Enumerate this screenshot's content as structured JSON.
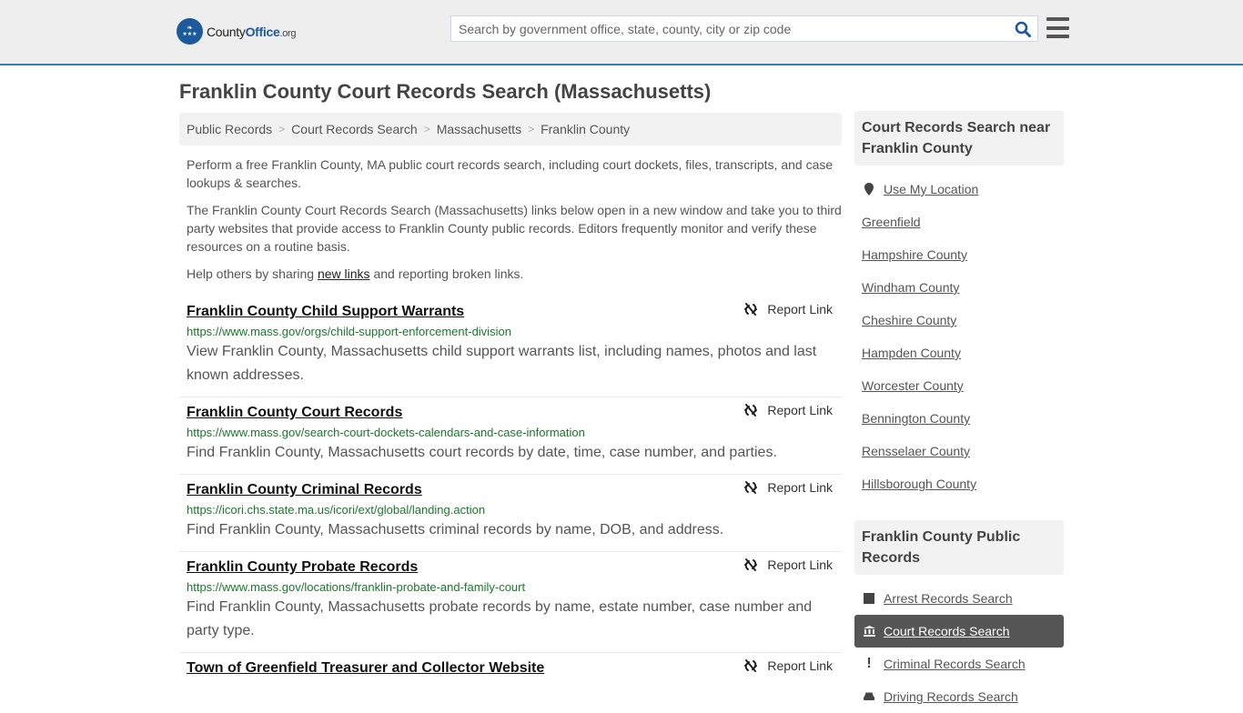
{
  "header": {
    "logo": {
      "name_part1": "County",
      "name_part2": "Office",
      "name_suffix": ".org"
    },
    "search": {
      "placeholder": "Search by government office, state, county, city or zip code",
      "value": ""
    },
    "icons": {
      "search": "search-icon",
      "menu": "hamburger-menu-icon"
    }
  },
  "page": {
    "title": "Franklin County Court Records Search (Massachusetts)"
  },
  "breadcrumb": [
    {
      "label": "Public Records"
    },
    {
      "label": "Court Records Search"
    },
    {
      "label": "Massachusetts"
    },
    {
      "label": "Franklin County"
    }
  ],
  "intro": {
    "p1": "Perform a free Franklin County, MA public court records search, including court dockets, files, transcripts, and case lookups & searches.",
    "p2": "The Franklin County Court Records Search (Massachusetts) links below open in a new window and take you to third party websites that provide access to Franklin County public records. Editors frequently monitor and verify these resources on a routine basis.",
    "p3_before": "Help others by sharing ",
    "p3_link": "new links",
    "p3_after": " and reporting broken links."
  },
  "report_label": "Report Link",
  "links": [
    {
      "title": "Franklin County Child Support Warrants",
      "url": "https://www.mass.gov/orgs/child-support-enforcement-division",
      "description": "View Franklin County, Massachusetts child support warrants list, including names, photos and last known addresses."
    },
    {
      "title": "Franklin County Court Records",
      "url": "https://www.mass.gov/search-court-dockets-calendars-and-case-information",
      "description": "Find Franklin County, Massachusetts court records by date, time, case number, and parties."
    },
    {
      "title": "Franklin County Criminal Records",
      "url": "https://icori.chs.state.ma.us/icori/ext/global/landing.action",
      "description": "Find Franklin County, Massachusetts criminal records by name, DOB, and address."
    },
    {
      "title": "Franklin County Probate Records",
      "url": "https://www.mass.gov/locations/franklin-probate-and-family-court",
      "description": "Find Franklin County, Massachusetts probate records by name, estate number, case number and party type."
    },
    {
      "title": "Town of Greenfield Treasurer and Collector Website",
      "url": "",
      "description": ""
    }
  ],
  "sidebar": {
    "nearby": {
      "heading": "Court Records Search near Franklin County",
      "use_location": "Use My Location",
      "items": [
        "Greenfield",
        "Hampshire County",
        "Windham County",
        "Cheshire County",
        "Hampden County",
        "Worcester County",
        "Bennington County",
        "Rensselaer County",
        "Hillsborough County"
      ]
    },
    "public_records": {
      "heading": "Franklin County Public Records",
      "items": [
        {
          "label": "Arrest Records Search",
          "icon": "square-icon",
          "active": false
        },
        {
          "label": "Court Records Search",
          "icon": "courthouse-icon",
          "active": true
        },
        {
          "label": "Criminal Records Search",
          "icon": "exclamation-icon",
          "active": false
        },
        {
          "label": "Driving Records Search",
          "icon": "car-icon",
          "active": false
        }
      ]
    }
  },
  "colors": {
    "brand_blue": "#1c5a9c",
    "header_border": "#3a7cb0",
    "url_green": "#1a7a2a",
    "active_bg": "#555555"
  }
}
